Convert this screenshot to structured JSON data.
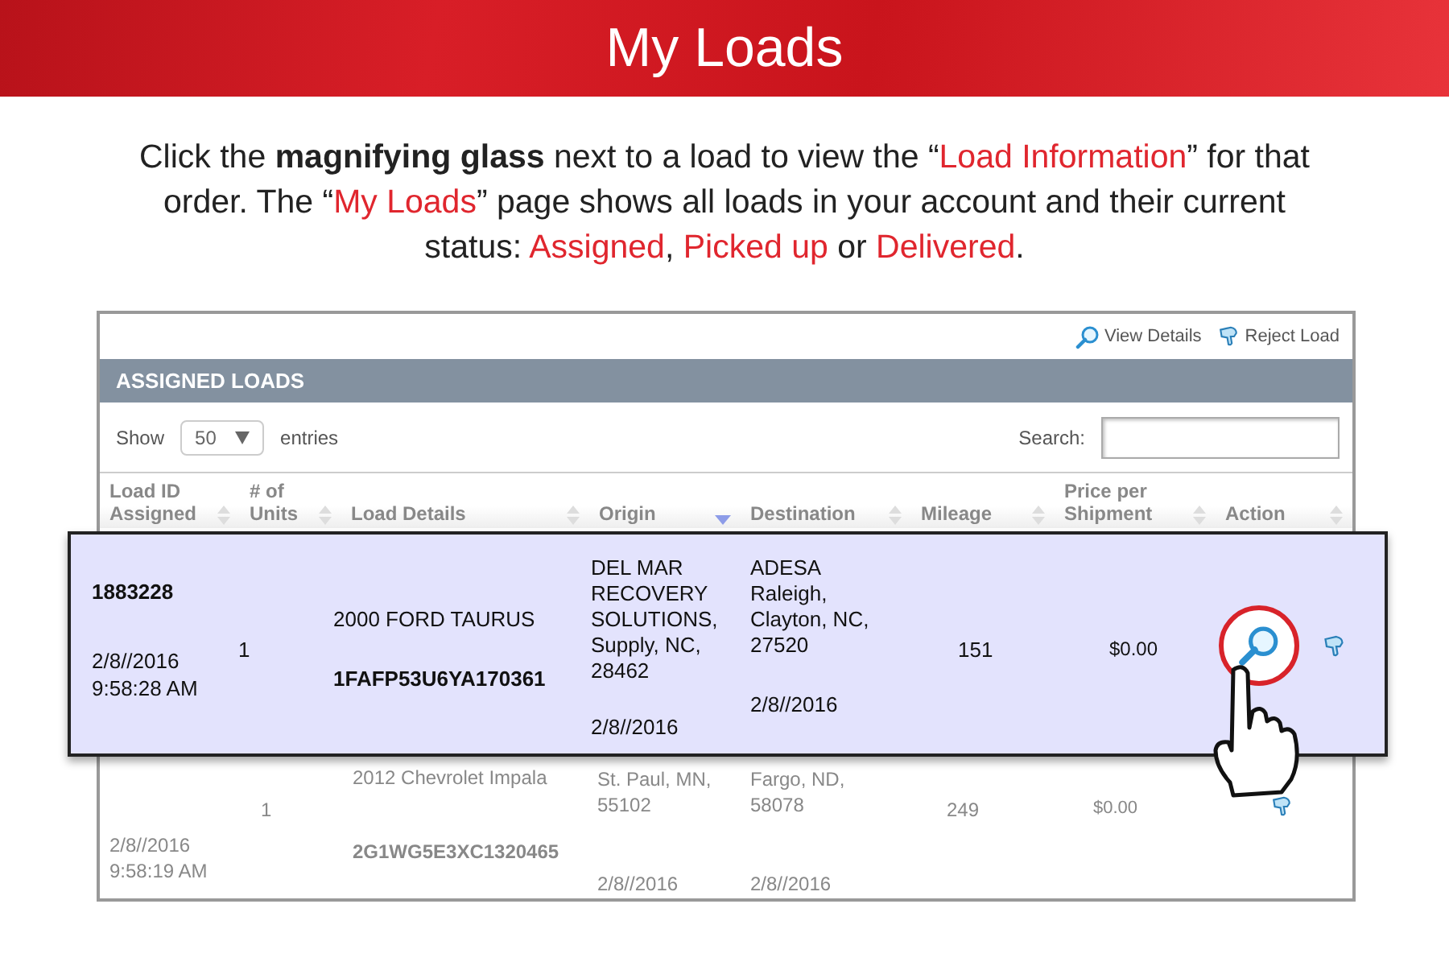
{
  "header": {
    "title": "My Loads"
  },
  "intro": [
    {
      "text": "Click the ",
      "kind": "plain"
    },
    {
      "text": "magnifying glass",
      "kind": "bold"
    },
    {
      "text": " next to a load to view the “",
      "kind": "plain"
    },
    {
      "text": "Load Information",
      "kind": "red"
    },
    {
      "text": "” for that order. The “",
      "kind": "plain"
    },
    {
      "text": "My Loads",
      "kind": "red"
    },
    {
      "text": "” page shows all loads in your account and their current status: ",
      "kind": "plain"
    },
    {
      "text": "Assigned",
      "kind": "red"
    },
    {
      "text": ", ",
      "kind": "plain"
    },
    {
      "text": "Picked up",
      "kind": "red"
    },
    {
      "text": " or ",
      "kind": "plain"
    },
    {
      "text": "Delivered",
      "kind": "red"
    },
    {
      "text": ".",
      "kind": "plain"
    }
  ],
  "toolbar": [
    {
      "label": "View Details",
      "kind": "view"
    },
    {
      "label": "Reject Load",
      "kind": "reject"
    }
  ],
  "section_title": "ASSIGNED LOADS",
  "length": {
    "label_before": "Show",
    "value": "50",
    "label_after": "entries"
  },
  "search": {
    "label": "Search:"
  },
  "columns": [
    {
      "label": "Load ID Assigned",
      "sorted": false
    },
    {
      "label": "# of Units",
      "sorted": false
    },
    {
      "label": "Load Details",
      "sorted": false
    },
    {
      "label": "Origin",
      "sorted": true
    },
    {
      "label": "Destination",
      "sorted": false
    },
    {
      "label": "Mileage",
      "sorted": false
    },
    {
      "label": "Price per Shipment",
      "sorted": false
    },
    {
      "label": "Action",
      "sorted": false
    }
  ],
  "highlighted_row": {
    "id": "1883228",
    "date": "2/8//2016",
    "time": "9:58:28 AM",
    "units": "1",
    "vehicle": "2000 FORD TAURUS",
    "vin": "1FAFP53U6YA170361",
    "origin": "DEL MAR RECOVERY SOLUTIONS, Supply, NC, 28462",
    "origin_date": "2/8//2016",
    "destination": "ADESA Raleigh, Clayton, NC, 27520",
    "destination_date": "2/8//2016",
    "mileage": "151",
    "price": "$0.00"
  },
  "rows": [
    {
      "date": "2/8//2016",
      "time": "9:58:19 AM",
      "units": "1",
      "vehicle": "2012 Chevrolet Impala",
      "vin": "2G1WG5E3XC1320465",
      "origin": "St. Paul, MN, 55102",
      "origin_date": "2/8//2016",
      "destination": "Fargo, ND, 58078",
      "destination_date": "2/8//2016",
      "mileage": "249",
      "price": "$0.00"
    }
  ]
}
